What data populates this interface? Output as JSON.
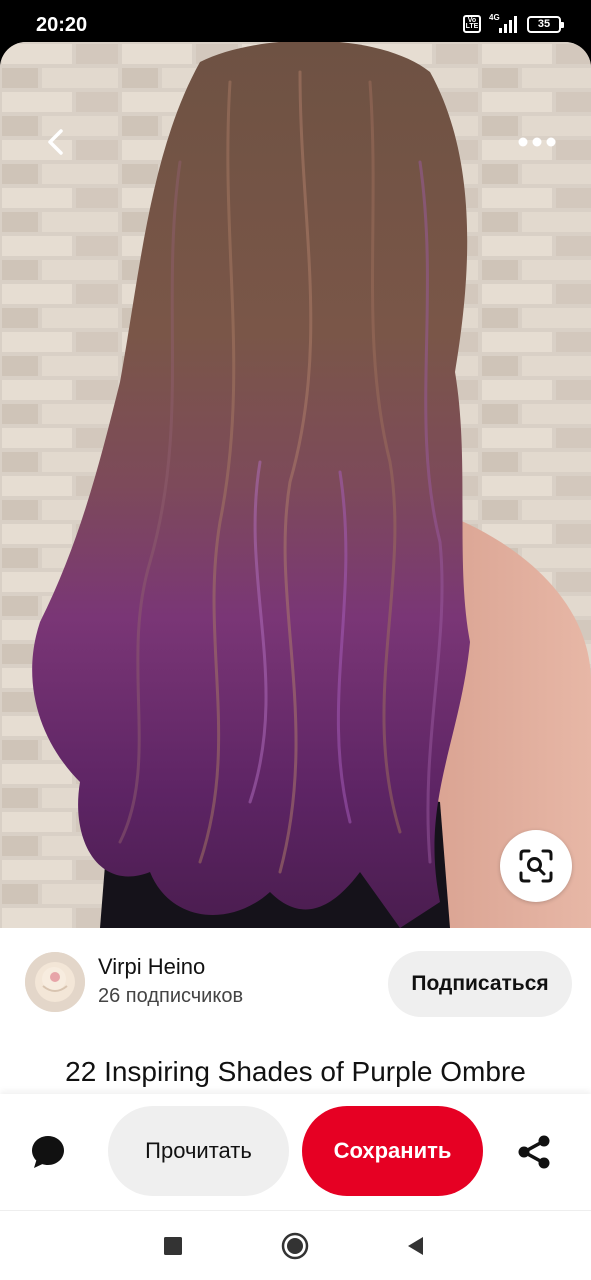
{
  "status_bar": {
    "time": "20:20",
    "network": "4G",
    "volte": "Vo LTE",
    "battery": "35"
  },
  "photo": {
    "back_icon": "chevron-left-icon",
    "more_icon": "more-dots-icon",
    "visual_search_icon": "visual-search-icon"
  },
  "creator": {
    "name": "Virpi Heino",
    "followers": "26 подписчиков",
    "follow_label": "Подписаться"
  },
  "pin": {
    "title": "22 Inspiring Shades of Purple Ombre"
  },
  "actions": {
    "comment_icon": "comment-bubble-icon",
    "read_label": "Прочитать",
    "save_label": "Сохранить",
    "share_icon": "share-icon",
    "save_color": "#e60023"
  },
  "nav": {
    "recents_icon": "square-icon",
    "home_icon": "circle-icon",
    "back_icon": "triangle-back-icon"
  }
}
